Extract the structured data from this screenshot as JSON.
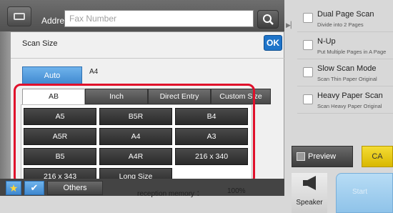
{
  "address": {
    "label": "Address",
    "placeholder": "Fax Number"
  },
  "panel": {
    "title": "Scan Size",
    "ok_label": "OK",
    "auto_label": "Auto",
    "size_value": "A4",
    "tabs": [
      "AB",
      "Inch",
      "Direct Entry",
      "Custom Size"
    ],
    "sizes": [
      "A5",
      "B5R",
      "B4",
      "A5R",
      "A4",
      "A3",
      "B5",
      "A4R",
      "216 x 340",
      "216 x 343",
      "Long Size"
    ],
    "bottom_text": "reception memory ："
  },
  "bottom": {
    "others_label": "Others",
    "memory_value": "100%"
  },
  "options": [
    {
      "title": "Dual Page Scan",
      "sub": "Divide into 2 Pages"
    },
    {
      "title": "N-Up",
      "sub": "Put Multiple Pages in A Page"
    },
    {
      "title": "Slow Scan Mode",
      "sub": "Scan Thin Paper Original"
    },
    {
      "title": "Heavy Paper Scan",
      "sub": "Scan Heavy Paper Original"
    }
  ],
  "actions": {
    "preview_label": "Preview",
    "ca_label": "CA",
    "speaker_label": "Speaker",
    "start_label": "Start"
  },
  "colors": {
    "highlight": "#e0102b",
    "accent_blue": "#1e74c9",
    "ca_yellow": "#f4dc35"
  }
}
